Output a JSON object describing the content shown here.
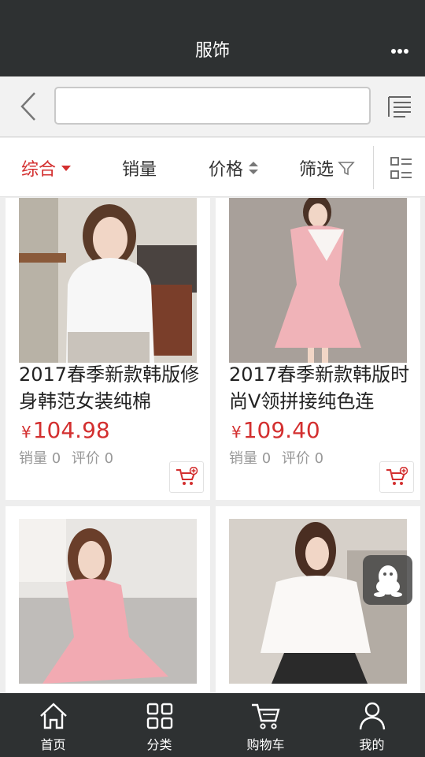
{
  "header": {
    "title": "服饰",
    "more_icon": "more-dots-icon"
  },
  "search": {
    "value": "",
    "placeholder": ""
  },
  "sort_bar": {
    "items": [
      {
        "label": "综合",
        "active": true
      },
      {
        "label": "销量",
        "active": false
      },
      {
        "label": "价格",
        "active": false
      },
      {
        "label": "筛选",
        "active": false
      }
    ]
  },
  "products": [
    {
      "name": "2017春季新款韩版修身韩范女装纯棉",
      "price_symbol": "¥",
      "price": "104.98",
      "sales_label": "销量 0",
      "reviews_label": "评价 0"
    },
    {
      "name": "2017春季新款韩版时尚V领拼接纯色连",
      "price_symbol": "¥",
      "price": "109.40",
      "sales_label": "销量 0",
      "reviews_label": "评价 0"
    },
    {
      "name": "",
      "price_symbol": "",
      "price": "",
      "sales_label": "",
      "reviews_label": ""
    },
    {
      "name": "",
      "price_symbol": "",
      "price": "",
      "sales_label": "",
      "reviews_label": ""
    }
  ],
  "bottom_nav": [
    {
      "label": "首页",
      "icon": "home-icon"
    },
    {
      "label": "分类",
      "icon": "grid-icon"
    },
    {
      "label": "购物车",
      "icon": "cart-icon"
    },
    {
      "label": "我的",
      "icon": "user-icon"
    }
  ],
  "colors": {
    "accent": "#d32f2f",
    "bar": "#2e3132"
  }
}
